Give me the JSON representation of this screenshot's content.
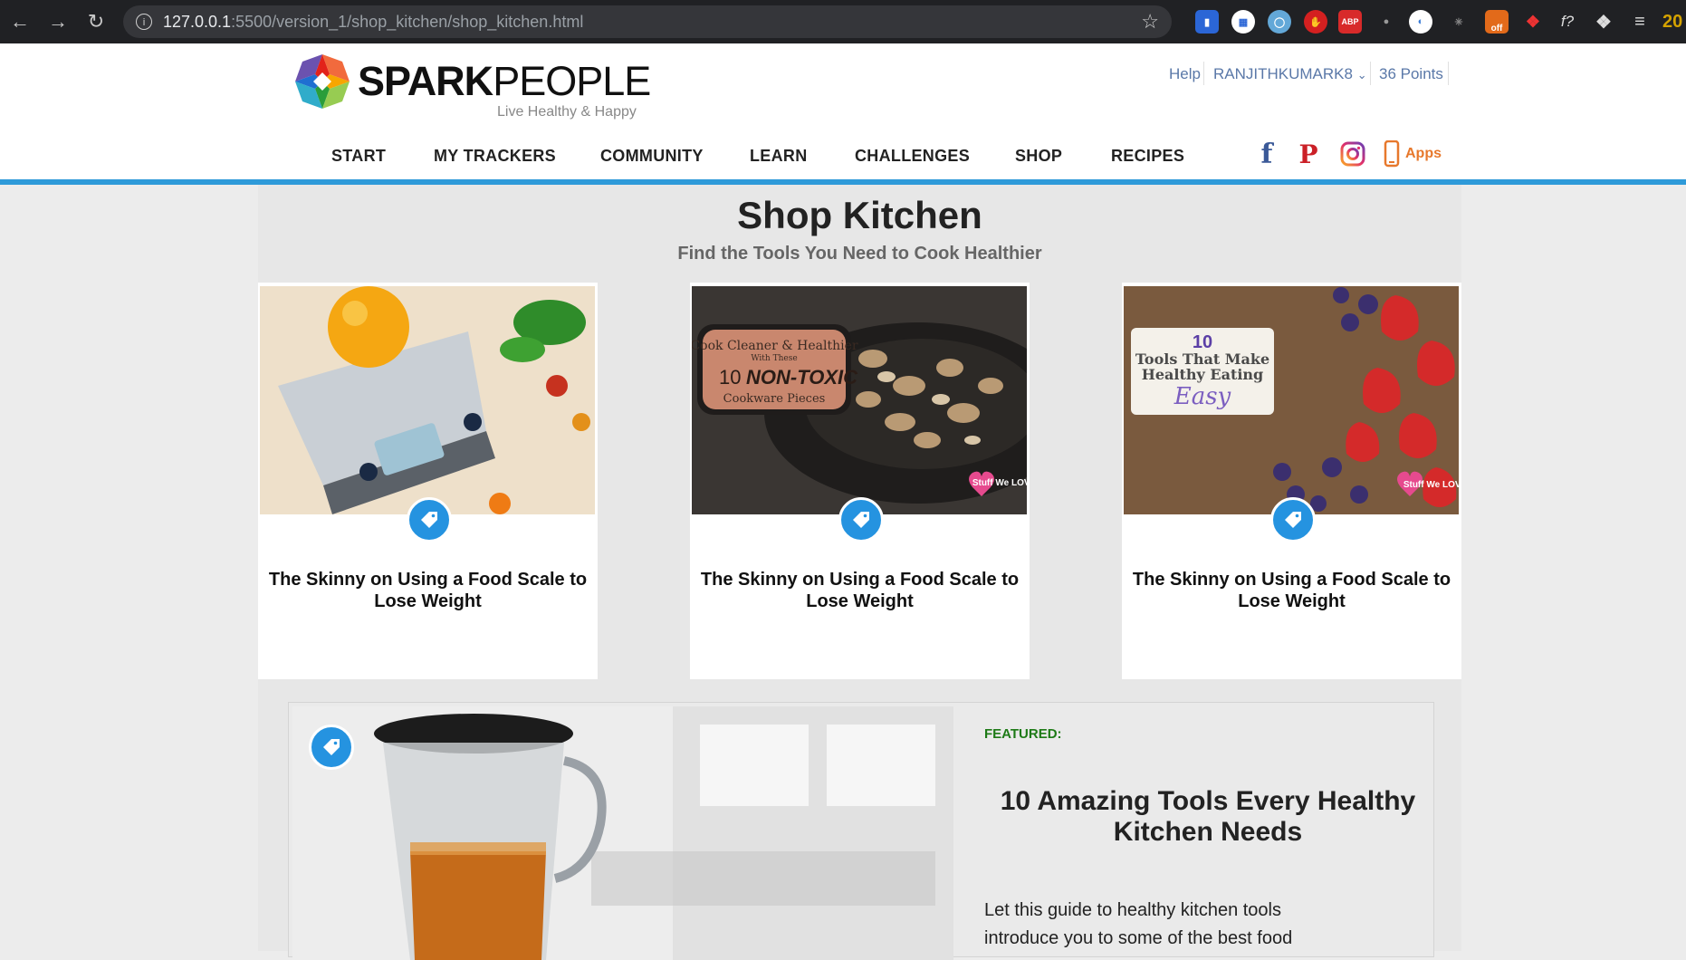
{
  "browser": {
    "url_host": "127.0.0.1",
    "url_path": ":5500/version_1/shop_kitchen/shop_kitchen.html",
    "extensions": [
      "bookmark-ext-icon",
      "grid-ext-icon",
      "globe-ext-icon",
      "red-hand-ext-icon",
      "abp-ext-icon",
      "gray-ext-icon",
      "circle-ext-icon",
      "gear-ext-icon",
      "off-ext-icon",
      "colorwheel-ext-icon",
      "formula-ext-icon",
      "puzzle-icon",
      "playlist-icon"
    ],
    "abp_label": "ABP",
    "off_label": "off",
    "formula_label": "f?",
    "cut_label": "20"
  },
  "header": {
    "brand_bold": "SPARK",
    "brand_light": "PEOPLE",
    "tagline": "Live Healthy & Happy",
    "help": "Help",
    "username": "RANJITHKUMARK8",
    "points": "36 Points",
    "apps": "Apps"
  },
  "nav": {
    "items": [
      "START",
      "MY TRACKERS",
      "COMMUNITY",
      "LEARN",
      "CHALLENGES",
      "SHOP",
      "RECIPES"
    ]
  },
  "page": {
    "title": "Shop Kitchen",
    "subtitle": "Find the Tools You Need to Cook Healthier"
  },
  "cards": [
    {
      "title": "The Skinny on Using a Food Scale to Lose Weight"
    },
    {
      "title": "The Skinny on Using a Food Scale to Lose Weight",
      "image_text": {
        "line1": "Cook Cleaner & Healthier",
        "line2": "With These",
        "num": "10",
        "em": "NON-TOXIC",
        "line3": "Cookware Pieces",
        "badge": "Stuff We LOVE"
      }
    },
    {
      "title": "The Skinny on Using a Food Scale to Lose Weight",
      "image_text": {
        "num": "10",
        "line1": "Tools That Make",
        "line2": "Healthy Eating",
        "em": "Easy",
        "badge": "Stuff We LOVE"
      }
    }
  ],
  "featured": {
    "label": "FEATURED:",
    "title": "10 Amazing Tools Every Healthy Kitchen Needs",
    "description": "Let this guide to healthy kitchen tools introduce you to some of the best food"
  },
  "colors": {
    "accent_blue": "#2e9ad9",
    "tag_blue": "#2593e0",
    "featured_green": "#1d7a16",
    "apps_orange": "#e7782c",
    "link_blue": "#5a78a8"
  }
}
